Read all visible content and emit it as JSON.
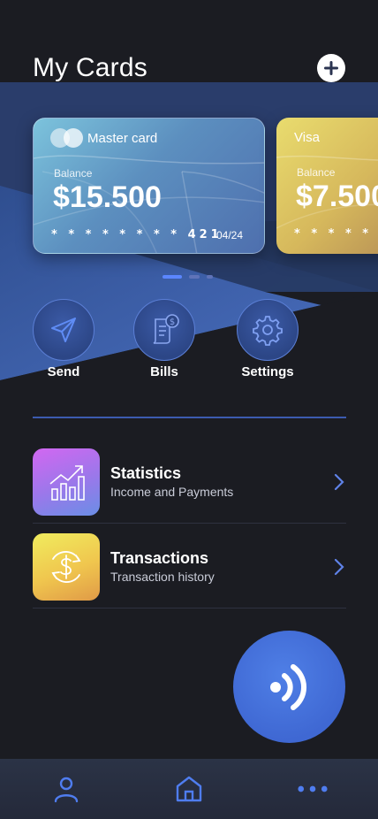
{
  "header": {
    "title": "My Cards"
  },
  "cards": [
    {
      "brand": "Master card",
      "balance_label": "Balance",
      "balance": "$15.500",
      "number": "* * * * * * * * 421",
      "expiry": "04/24"
    },
    {
      "brand": "Visa",
      "balance_label": "Balance",
      "balance": "$7.500",
      "number": "* * * * * * *"
    }
  ],
  "actions": [
    {
      "label": "Send",
      "icon": "send-icon"
    },
    {
      "label": "Bills",
      "icon": "bill-icon"
    },
    {
      "label": "Settings",
      "icon": "gear-icon"
    }
  ],
  "menu": [
    {
      "title": "Statistics",
      "subtitle": "Income and Payments",
      "icon": "chart-icon"
    },
    {
      "title": "Transactions",
      "subtitle": "Transaction history",
      "icon": "dollar-exchange-icon"
    }
  ],
  "nav": [
    {
      "icon": "user-icon"
    },
    {
      "icon": "home-icon"
    },
    {
      "icon": "more-icon"
    }
  ],
  "colors": {
    "background": "#1b1c22",
    "accent": "#3f68d3",
    "nav": "#2b3346"
  }
}
